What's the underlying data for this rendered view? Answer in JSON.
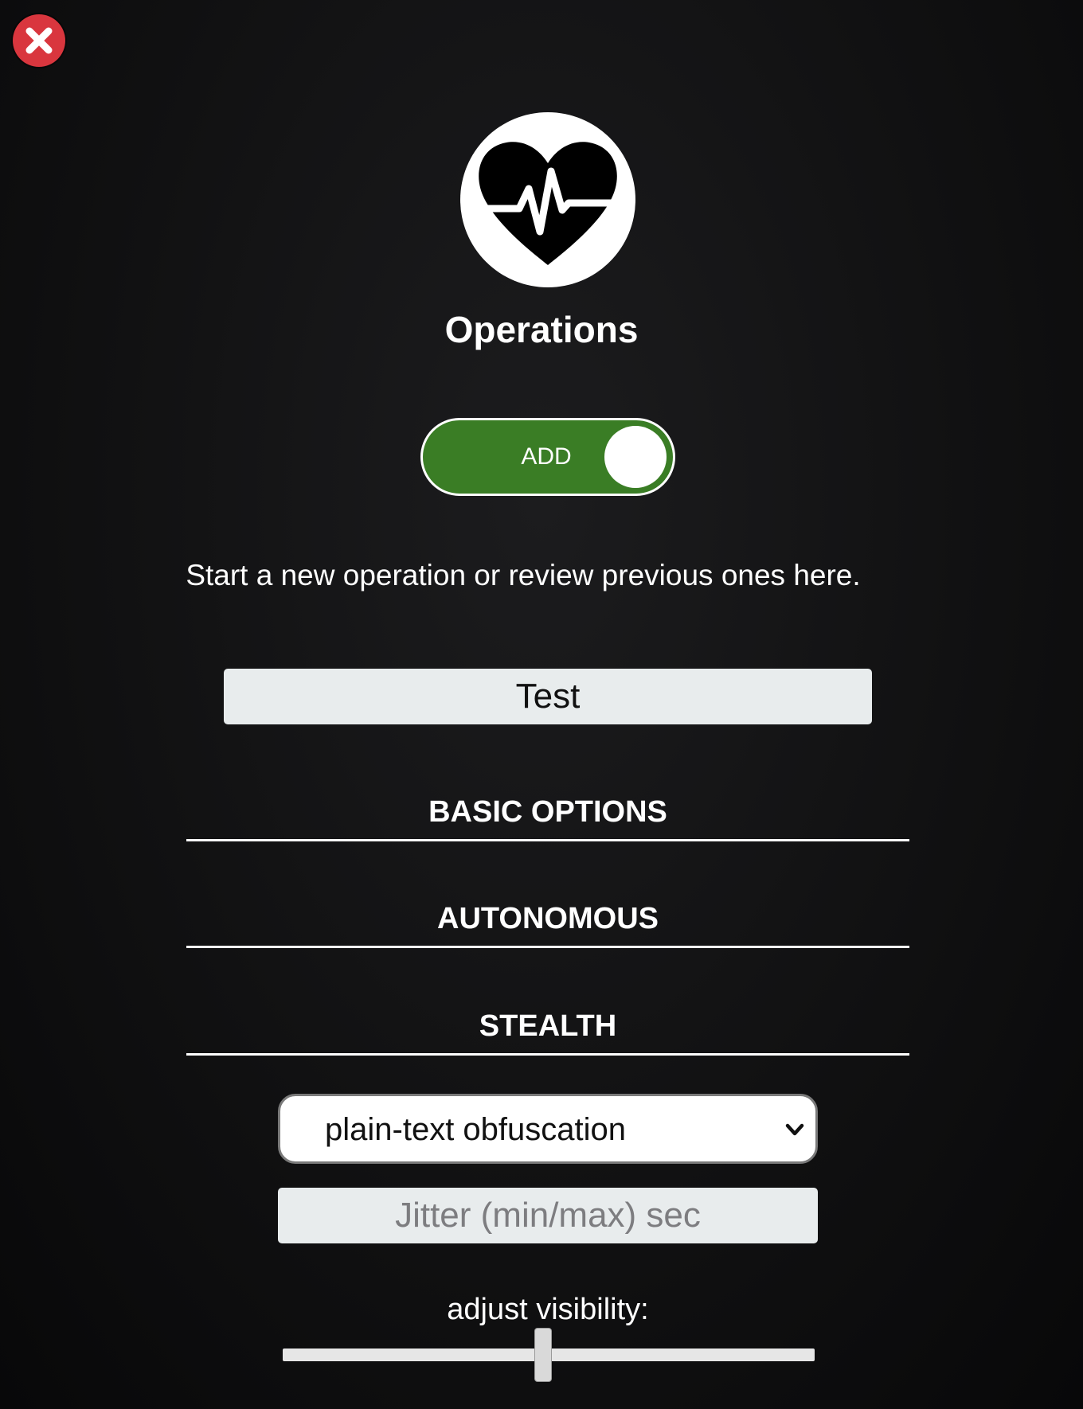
{
  "header": {
    "close_icon": "close-icon"
  },
  "logo": {
    "icon": "heart-pulse-icon"
  },
  "title": "Operations",
  "toggle": {
    "label": "ADD",
    "state": "on",
    "color": "#3a7d25"
  },
  "subtitle": "Start a new operation or review previous ones here.",
  "operation_name": {
    "value": "Test"
  },
  "sections": [
    {
      "label": "BASIC OPTIONS"
    },
    {
      "label": "AUTONOMOUS"
    },
    {
      "label": "STEALTH"
    }
  ],
  "obfuscation_select": {
    "selected": "plain-text obfuscation",
    "icon": "chevron-down-icon"
  },
  "jitter": {
    "placeholder": "Jitter (min/max) sec",
    "value": ""
  },
  "visibility": {
    "label": "adjust visibility:",
    "value_fraction": 0.49
  },
  "colors": {
    "close": "#d9363e",
    "toggle_on": "#3a7d25",
    "background": "#0e0e0f"
  }
}
